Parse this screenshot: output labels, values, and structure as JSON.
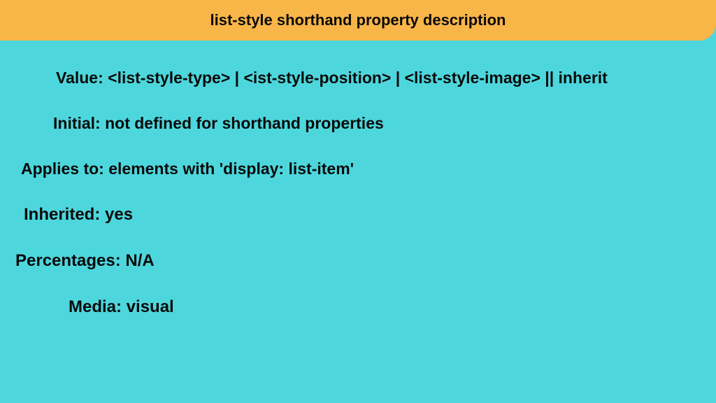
{
  "header": {
    "title": "list-style shorthand property description"
  },
  "rows": {
    "value": "Value: <list-style-type> | <ist-style-position> | <list-style-image> || inherit",
    "initial": "Initial: not defined for shorthand properties",
    "applies_to": "Applies to: elements with 'display: list-item'",
    "inherited": "Inherited: yes",
    "percentages": "Percentages: N/A",
    "media": "Media: visual"
  }
}
